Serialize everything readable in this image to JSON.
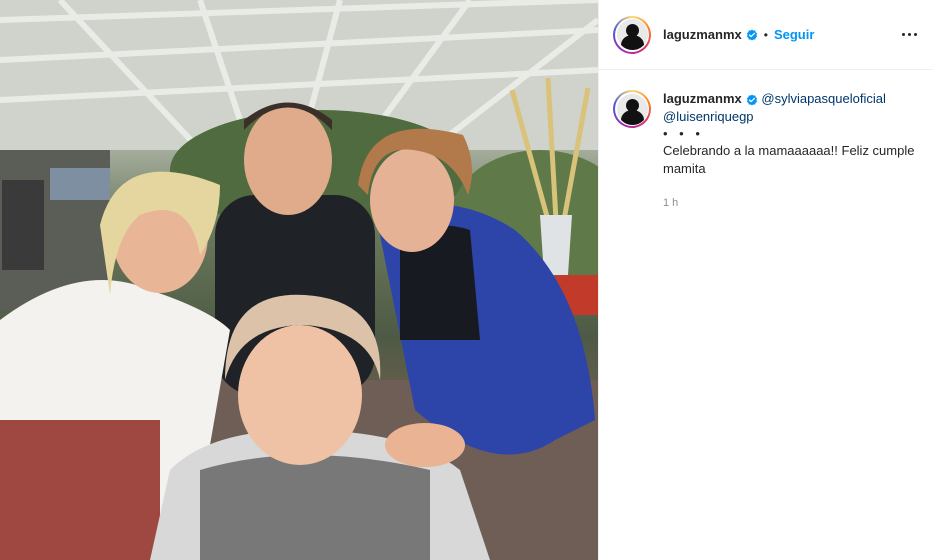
{
  "post": {
    "author": "laguzmanmx",
    "follow_label": "Seguir",
    "header_separator": "•",
    "more_icon": "more-horizontal-icon",
    "verified_icon": "verified-badge-icon"
  },
  "caption": {
    "author": "laguzmanmx",
    "mention_1": "@sylviapasqueloficial",
    "mention_2": "@luisenriquegp",
    "dots": "• • •",
    "text": "Celebrando a la mamaaaaaa!! Feliz cumple mamita",
    "time": "1 h"
  },
  "colors": {
    "follow_blue": "#0095f6",
    "verified_blue": "#0095f6",
    "mention": "#00376b",
    "muted": "#8e8e8e"
  }
}
